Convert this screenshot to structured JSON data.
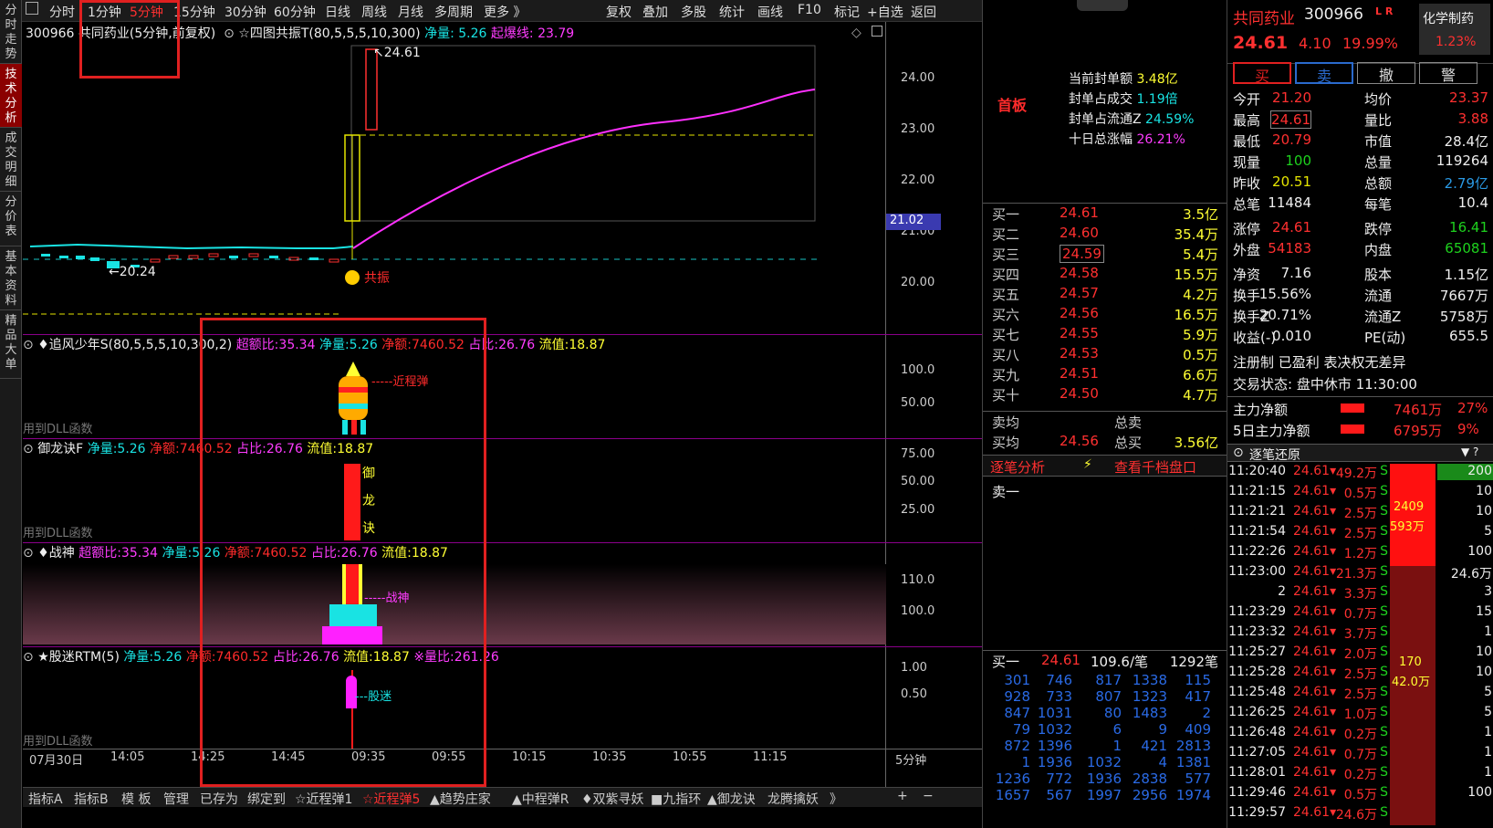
{
  "sidebar": {
    "tabs": [
      "分时走势",
      "技术分析",
      "成交明细",
      "分价表",
      "基本资料",
      "精品大单"
    ]
  },
  "topbar": {
    "periods": [
      "分时",
      "1分钟",
      "5分钟",
      "15分钟",
      "30分钟",
      "60分钟",
      "日线",
      "周线",
      "月线",
      "多周期",
      "更多 》"
    ],
    "active": "5分钟",
    "tools": [
      "复权",
      "叠加",
      "多股",
      "统计",
      "画线",
      "F10",
      "标记",
      "+自选",
      "返回"
    ]
  },
  "stock_title": "300966 共同药业(5分钟,前复权)",
  "main_indicator": {
    "name": "☆四图共振T(80,5,5,5,10,300)",
    "jl_label": "净量:",
    "jl": "5.26",
    "qb_label": "起爆线:",
    "qb": "23.79"
  },
  "price_axis": [
    "24.00",
    "23.00",
    "22.00",
    "21.00",
    "20.00"
  ],
  "price_marker": "21.02",
  "price_labels": {
    "high": "24.61",
    "low": "20.24",
    "gz": "共振"
  },
  "panels": {
    "p1": {
      "name": "♦追风少年S(80,5,5,5,10,300,2)",
      "items": [
        [
          "超额比:",
          "35.34"
        ],
        [
          "净量:",
          "5.26"
        ],
        [
          "净额:",
          "7460.52"
        ],
        [
          "占比:",
          "26.76"
        ],
        [
          "流值:",
          "18.87"
        ]
      ],
      "axis": [
        "100.0",
        "50.00"
      ],
      "tag": "近程弹",
      "dll": "用到DLL函数"
    },
    "p2": {
      "name": "御龙诀F",
      "items": [
        [
          "净量:",
          "5.26"
        ],
        [
          "净额:",
          "7460.52"
        ],
        [
          "占比:",
          "26.76"
        ],
        [
          "流值:",
          "18.87"
        ]
      ],
      "axis": [
        "75.00",
        "50.00",
        "25.00"
      ],
      "chars": [
        "御",
        "龙",
        "诀"
      ],
      "dll": "用到DLL函数"
    },
    "p3": {
      "name": "♦战神",
      "items": [
        [
          "超额比:",
          "35.34"
        ],
        [
          "净量:",
          "5.26"
        ],
        [
          "净额:",
          "7460.52"
        ],
        [
          "占比:",
          "26.76"
        ],
        [
          "流值:",
          "18.87"
        ]
      ],
      "axis": [
        "110.0",
        "100.0"
      ],
      "tag": "战神"
    },
    "p4": {
      "name": "★股迷RTM(5)",
      "items": [
        [
          "净量:",
          "5.26"
        ],
        [
          "净额:",
          "7460.52"
        ],
        [
          "占比:",
          "26.76"
        ],
        [
          "流值:",
          "18.87"
        ],
        [
          "※量比:",
          "261.26"
        ]
      ],
      "axis": [
        "1.00",
        "0.50"
      ],
      "tag": "股迷",
      "dll": "用到DLL函数"
    }
  },
  "time_axis": [
    "07月30日",
    "14:05",
    "14:25",
    "14:45",
    "09:35",
    "09:55",
    "10:15",
    "10:35",
    "10:55",
    "11:15"
  ],
  "period_label": "5分钟",
  "bottom_tabs": [
    "指标A",
    "指标B",
    "模 板",
    "管理",
    "已存为",
    "绑定到",
    "☆近程弹1",
    "☆近程弹5",
    "▲趋势庄家",
    "▲中程弹R",
    "♦双紫寻妖",
    "■九指环",
    "▲御龙诀",
    "龙腾擒妖",
    "》"
  ],
  "seal": {
    "board": "首板",
    "rows": [
      [
        "当前封单额",
        "3.48亿"
      ],
      [
        "封单占成交",
        "1.19倍"
      ],
      [
        "封单占流通Z",
        "24.59%"
      ],
      [
        "十日总涨幅",
        "26.21%"
      ]
    ]
  },
  "bids": [
    [
      "买一",
      "24.61",
      "3.5亿"
    ],
    [
      "买二",
      "24.60",
      "35.4万"
    ],
    [
      "买三",
      "24.59",
      "5.4万"
    ],
    [
      "买四",
      "24.58",
      "15.5万"
    ],
    [
      "买五",
      "24.57",
      "4.2万"
    ],
    [
      "买六",
      "24.56",
      "16.5万"
    ],
    [
      "买七",
      "24.55",
      "5.9万"
    ],
    [
      "买八",
      "24.53",
      "0.5万"
    ],
    [
      "买九",
      "24.51",
      "6.6万"
    ],
    [
      "买十",
      "24.50",
      "4.7万"
    ]
  ],
  "avg": {
    "sell_label": "卖均",
    "sell_total_label": "总卖",
    "buy_label": "买均",
    "buy": "24.56",
    "buy_total_label": "总买",
    "buy_total": "3.56亿"
  },
  "zbfx": {
    "title": "逐笔分析",
    "link": "查看千档盘口",
    "sell1": "卖一"
  },
  "queue": {
    "label": "买一",
    "price": "24.61",
    "per": "109.6/笔",
    "count": "1292笔",
    "rows": [
      [
        "301",
        "746",
        "817",
        "1338",
        "115"
      ],
      [
        "928",
        "733",
        "807",
        "1323",
        "417"
      ],
      [
        "847",
        "1031",
        "80",
        "1483",
        "2"
      ],
      [
        "79",
        "1032",
        "6",
        "9",
        "409"
      ],
      [
        "872",
        "1396",
        "1",
        "421",
        "2813"
      ],
      [
        "1",
        "1936",
        "1032",
        "4",
        "1381"
      ],
      [
        "1236",
        "772",
        "1936",
        "2838",
        "577"
      ],
      [
        "1657",
        "567",
        "1997",
        "2956",
        "1974"
      ]
    ]
  },
  "quote": {
    "name": "共同药业",
    "code": "300966",
    "flag": "L R",
    "sector": "化学制药",
    "sector_pct": "1.23%",
    "price": "24.61",
    "chg": "4.10",
    "pct": "19.99%",
    "buttons": [
      "买",
      "卖",
      "撤",
      "警"
    ],
    "rows": [
      [
        "今开",
        "21.20",
        "均价",
        "23.37"
      ],
      [
        "最高",
        "24.61",
        "量比",
        "3.88"
      ],
      [
        "最低",
        "20.79",
        "市值",
        "28.4亿"
      ],
      [
        "现量",
        "100",
        "总量",
        "119264"
      ],
      [
        "昨收",
        "20.51",
        "总额",
        "2.79亿"
      ],
      [
        "总笔",
        "11484",
        "每笔",
        "10.4"
      ],
      [
        "涨停",
        "24.61",
        "跌停",
        "16.41"
      ],
      [
        "外盘",
        "54183",
        "内盘",
        "65081"
      ],
      [
        "净资",
        "7.16",
        "股本",
        "1.15亿"
      ],
      [
        "换手",
        "15.56%",
        "流通",
        "7667万"
      ],
      [
        "换手Z",
        "20.71%",
        "流通Z",
        "5758万"
      ],
      [
        "收益(-)",
        "0.010",
        "PE(动)",
        "655.5"
      ]
    ],
    "reg": "注册制 已盈利 表决权无差异",
    "status": "交易状态: 盘中休市 11:30:00",
    "zl": [
      [
        "主力净额",
        "7461万",
        "27%"
      ],
      [
        "5日主力净额",
        "6795万",
        "9%"
      ]
    ]
  },
  "trades_title": "逐笔还原",
  "trades": [
    [
      "11:20:40",
      "24.61",
      "49.2万",
      "S"
    ],
    [
      "11:21:15",
      "24.61",
      "0.5万",
      "S"
    ],
    [
      "11:21:21",
      "24.61",
      "2.5万",
      "S"
    ],
    [
      "11:21:54",
      "24.61",
      "2.5万",
      "S"
    ],
    [
      "11:22:26",
      "24.61",
      "1.2万",
      "S"
    ],
    [
      "11:23:00",
      "24.61",
      "21.3万",
      "S"
    ],
    [
      "2",
      "24.61",
      "3.3万",
      "S"
    ],
    [
      "11:23:29",
      "24.61",
      "0.7万",
      "S"
    ],
    [
      "11:23:32",
      "24.61",
      "3.7万",
      "S"
    ],
    [
      "11:25:27",
      "24.61",
      "2.0万",
      "S"
    ],
    [
      "11:25:28",
      "24.61",
      "2.5万",
      "S"
    ],
    [
      "11:25:48",
      "24.61",
      "2.5万",
      "S"
    ],
    [
      "11:26:25",
      "24.61",
      "1.0万",
      "S"
    ],
    [
      "11:26:48",
      "24.61",
      "0.2万",
      "S"
    ],
    [
      "11:27:05",
      "24.61",
      "0.7万",
      "S"
    ],
    [
      "11:28:01",
      "24.61",
      "0.2万",
      "S"
    ],
    [
      "11:29:46",
      "24.61",
      "0.5万",
      "S"
    ],
    [
      "11:29:57",
      "24.61",
      "24.6万",
      "S"
    ]
  ],
  "trade_bars": {
    "top_n": "2409",
    "top_v": "593万",
    "bot_n": "170",
    "bot_v": "42.0万"
  },
  "right_col": [
    "200",
    "10",
    "10",
    "5",
    "100",
    "24.6万",
    "3",
    "15",
    "1",
    "10",
    "10",
    "5",
    "5",
    "1",
    "1",
    "1",
    "100"
  ]
}
